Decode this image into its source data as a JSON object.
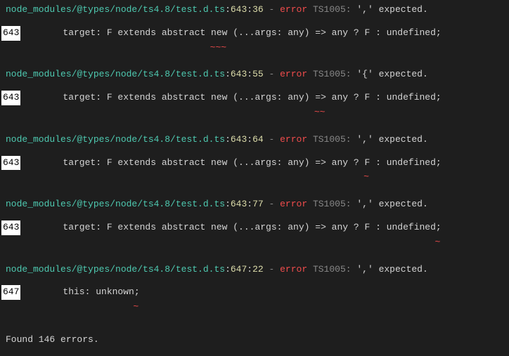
{
  "errors": [
    {
      "file": "node_modules/@types/node/ts4.8/test.d.ts",
      "line": "643",
      "col": "36",
      "errorWord": "error",
      "tsCode": "TS1005:",
      "message": "',' expected.",
      "gutter": "643",
      "code": "target: F extends abstract new (...args: any) => any ? F : undefined;",
      "squigglePad": "                           ",
      "squiggle": "~~~"
    },
    {
      "file": "node_modules/@types/node/ts4.8/test.d.ts",
      "line": "643",
      "col": "55",
      "errorWord": "error",
      "tsCode": "TS1005:",
      "message": "'{' expected.",
      "gutter": "643",
      "code": "target: F extends abstract new (...args: any) => any ? F : undefined;",
      "squigglePad": "                                              ",
      "squiggle": "~~"
    },
    {
      "file": "node_modules/@types/node/ts4.8/test.d.ts",
      "line": "643",
      "col": "64",
      "errorWord": "error",
      "tsCode": "TS1005:",
      "message": "',' expected.",
      "gutter": "643",
      "code": "target: F extends abstract new (...args: any) => any ? F : undefined;",
      "squigglePad": "                                                       ",
      "squiggle": "~"
    },
    {
      "file": "node_modules/@types/node/ts4.8/test.d.ts",
      "line": "643",
      "col": "77",
      "errorWord": "error",
      "tsCode": "TS1005:",
      "message": "',' expected.",
      "gutter": "643",
      "code": "target: F extends abstract new (...args: any) => any ? F : undefined;",
      "squigglePad": "                                                                    ",
      "squiggle": "~"
    },
    {
      "file": "node_modules/@types/node/ts4.8/test.d.ts",
      "line": "647",
      "col": "22",
      "errorWord": "error",
      "tsCode": "TS1005:",
      "message": "',' expected.",
      "gutter": "647",
      "code": "this: unknown;",
      "squigglePad": "             ",
      "squiggle": "~"
    }
  ],
  "summary": "Found 146 errors."
}
